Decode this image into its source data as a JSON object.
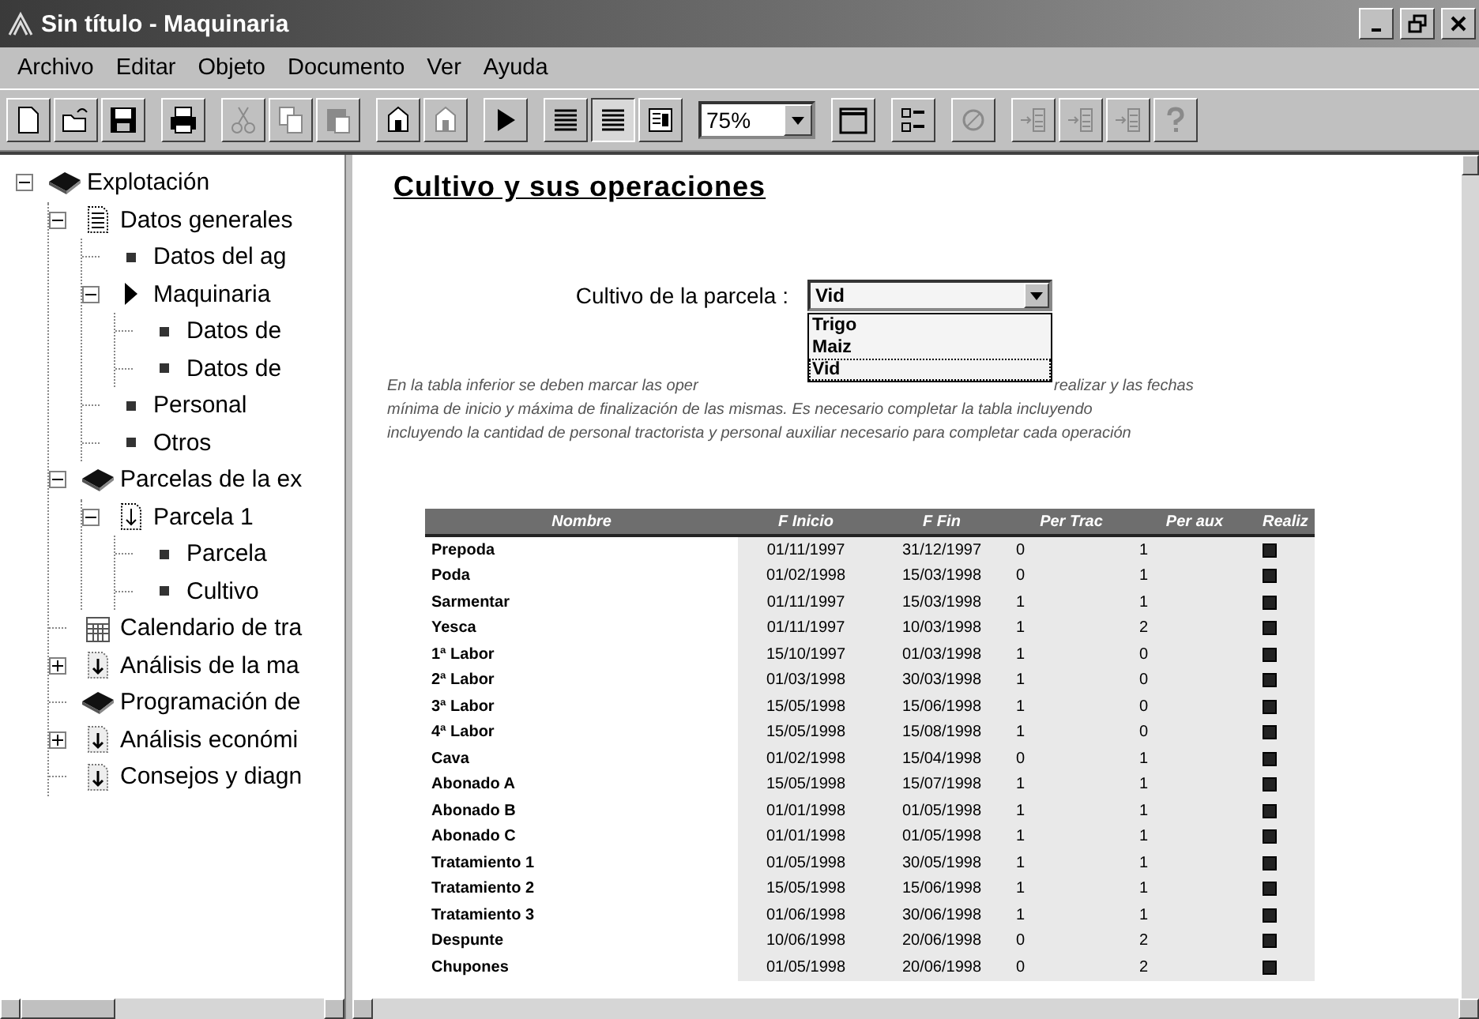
{
  "window": {
    "title": "Sin título - Maquinaria"
  },
  "menu": [
    "Archivo",
    "Editar",
    "Objeto",
    "Documento",
    "Ver",
    "Ayuda"
  ],
  "toolbar": {
    "groups": [
      [
        {
          "kind": "new",
          "disabled": false
        },
        {
          "kind": "open",
          "disabled": false
        },
        {
          "kind": "save",
          "disabled": false
        }
      ],
      [
        {
          "kind": "print",
          "disabled": false
        }
      ],
      [
        {
          "kind": "cut",
          "disabled": true
        },
        {
          "kind": "copy",
          "disabled": true
        },
        {
          "kind": "paste",
          "disabled": true
        }
      ],
      [
        {
          "kind": "tool",
          "disabled": false
        },
        {
          "kind": "tool",
          "disabled": true
        }
      ],
      [
        {
          "kind": "play",
          "disabled": false
        }
      ],
      [
        {
          "kind": "lines",
          "disabled": false,
          "selected": false
        },
        {
          "kind": "lines",
          "disabled": false,
          "selected": true
        },
        {
          "kind": "panel",
          "disabled": false,
          "selected": false
        }
      ],
      [
        {
          "kind": "zoom",
          "value": "75%"
        }
      ],
      [
        {
          "kind": "window",
          "disabled": false
        }
      ],
      [
        {
          "kind": "tree",
          "disabled": false
        }
      ],
      [
        {
          "kind": "circle",
          "disabled": true
        }
      ],
      [
        {
          "kind": "indent",
          "disabled": true
        },
        {
          "kind": "indent",
          "disabled": true
        },
        {
          "kind": "indent",
          "disabled": true
        },
        {
          "kind": "help",
          "disabled": true
        }
      ]
    ]
  },
  "tree": [
    {
      "label": "Explotación",
      "kind": "book",
      "expanded": true,
      "children": [
        {
          "label": "Datos generales",
          "kind": "doc",
          "expanded": true,
          "children": [
            {
              "label": "Datos del ag",
              "kind": "bullet"
            },
            {
              "label": "Maquinaria",
              "kind": "arrow",
              "expanded": true,
              "children": [
                {
                  "label": "Datos de",
                  "kind": "bullet"
                },
                {
                  "label": "Datos de",
                  "kind": "bullet"
                }
              ]
            },
            {
              "label": "Personal",
              "kind": "bullet"
            },
            {
              "label": "Otros",
              "kind": "bullet"
            }
          ]
        },
        {
          "label": "Parcelas de la ex",
          "kind": "book",
          "expanded": true,
          "children": [
            {
              "label": "Parcela 1",
              "kind": "page",
              "expanded": true,
              "children": [
                {
                  "label": "Parcela",
                  "kind": "bullet"
                },
                {
                  "label": "Cultivo",
                  "kind": "bullet"
                }
              ]
            }
          ]
        },
        {
          "label": "Calendario de tra",
          "kind": "calendar"
        },
        {
          "label": "Análisis de la ma",
          "kind": "download",
          "expanded": false
        },
        {
          "label": "Programación de",
          "kind": "book"
        },
        {
          "label": "Análisis económi",
          "kind": "download",
          "expanded": false
        },
        {
          "label": "Consejos y diagn",
          "kind": "download"
        }
      ]
    }
  ],
  "document": {
    "title": "Cultivo y sus operaciones",
    "crop_field": {
      "label": "Cultivo de la parcela :",
      "value": "Vid",
      "options": [
        {
          "label": "Trigo",
          "selected": false
        },
        {
          "label": "Maiz",
          "selected": false
        },
        {
          "label": "Vid",
          "selected": true
        }
      ]
    },
    "description_lines": [
      [
        "En la tabla inferior se deben marcar las oper",
        "realizar y las fechas"
      ],
      [
        "mínima de inicio y máxima de finalización de las mismas. Es necesario completar la tabla incluyendo"
      ],
      [
        "incluyendo la cantidad de personal tractorista y personal auxiliar necesario para completar cada operación"
      ]
    ],
    "table": {
      "columns": [
        "Nombre",
        "F Inicio",
        "F Fin",
        "Per Trac",
        "Per aux",
        "Realiz"
      ],
      "rows": [
        {
          "cells": [
            "Prepoda",
            "01/11/1997",
            "31/12/1997",
            "0",
            "1"
          ],
          "checked": true
        },
        {
          "cells": [
            "Poda",
            "01/02/1998",
            "15/03/1998",
            "0",
            "1"
          ],
          "checked": true
        },
        {
          "cells": [
            "Sarmentar",
            "01/11/1997",
            "15/03/1998",
            "1",
            "1"
          ],
          "checked": true
        },
        {
          "cells": [
            "Yesca",
            "01/11/1997",
            "10/03/1998",
            "1",
            "2"
          ],
          "checked": true
        },
        {
          "cells": [
            "1ª Labor",
            "15/10/1997",
            "01/03/1998",
            "1",
            "0"
          ],
          "checked": true
        },
        {
          "cells": [
            "2ª Labor",
            "01/03/1998",
            "30/03/1998",
            "1",
            "0"
          ],
          "checked": true
        },
        {
          "cells": [
            "3ª Labor",
            "15/05/1998",
            "15/06/1998",
            "1",
            "0"
          ],
          "checked": true
        },
        {
          "cells": [
            "4ª Labor",
            "15/05/1998",
            "15/08/1998",
            "1",
            "0"
          ],
          "checked": true
        },
        {
          "cells": [
            "Cava",
            "01/02/1998",
            "15/04/1998",
            "0",
            "1"
          ],
          "checked": true
        },
        {
          "cells": [
            "Abonado A",
            "15/05/1998",
            "15/07/1998",
            "1",
            "1"
          ],
          "checked": true
        },
        {
          "cells": [
            "Abonado B",
            "01/01/1998",
            "01/05/1998",
            "1",
            "1"
          ],
          "checked": true
        },
        {
          "cells": [
            "Abonado C",
            "01/01/1998",
            "01/05/1998",
            "1",
            "1"
          ],
          "checked": true
        },
        {
          "cells": [
            "Tratamiento 1",
            "01/05/1998",
            "30/05/1998",
            "1",
            "1"
          ],
          "checked": true
        },
        {
          "cells": [
            "Tratamiento 2",
            "15/05/1998",
            "15/06/1998",
            "1",
            "1"
          ],
          "checked": true
        },
        {
          "cells": [
            "Tratamiento 3",
            "01/06/1998",
            "30/06/1998",
            "1",
            "1"
          ],
          "checked": true
        },
        {
          "cells": [
            "Despunte",
            "10/06/1998",
            "20/06/1998",
            "0",
            "2"
          ],
          "checked": true
        },
        {
          "cells": [
            "Chupones",
            "01/05/1998",
            "20/06/1998",
            "0",
            "2"
          ],
          "checked": true
        }
      ]
    }
  }
}
